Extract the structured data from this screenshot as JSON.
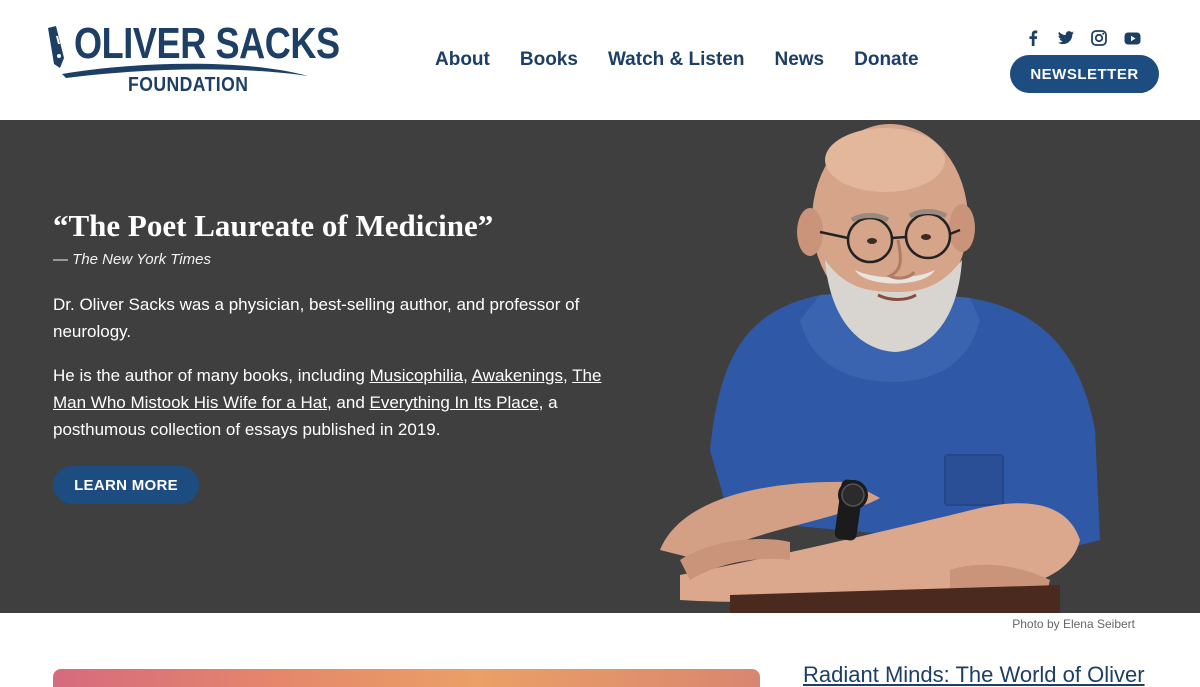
{
  "brand": {
    "name_line1": "OLIVER SACKS",
    "name_line2": "FOUNDATION",
    "color": "#1d3f66"
  },
  "nav": {
    "items": [
      {
        "label": "About"
      },
      {
        "label": "Books"
      },
      {
        "label": "Watch & Listen"
      },
      {
        "label": "News"
      },
      {
        "label": "Donate"
      }
    ]
  },
  "social": {
    "icons": [
      "facebook-icon",
      "twitter-icon",
      "instagram-icon",
      "youtube-icon"
    ]
  },
  "header": {
    "newsletter_label": "NEWSLETTER"
  },
  "hero": {
    "quote": "“The Poet Laureate of Medicine”",
    "quote_source": "— The New York Times",
    "paragraph1": "Dr. Oliver Sacks was a physician, best-selling author, and professor of neurology.",
    "paragraph2_intro": "He is the author of many books, including ",
    "book1": "Musicophilia",
    "sep1": ", ",
    "book2": "Awakenings",
    "sep2": ", ",
    "book3": "The Man Who Mistook His Wife for a Hat",
    "sep3": ", and ",
    "book4": "Everything In Its Place",
    "paragraph2_outro": ", a posthumous collection of essays published in 2019.",
    "cta_label": "LEARN MORE",
    "background": "#3f3f3f",
    "accent": "#1d4d80"
  },
  "photo": {
    "caption": "Photo by Elena Seibert"
  },
  "feature": {
    "title": "Radiant Minds: The World of Oliver"
  }
}
